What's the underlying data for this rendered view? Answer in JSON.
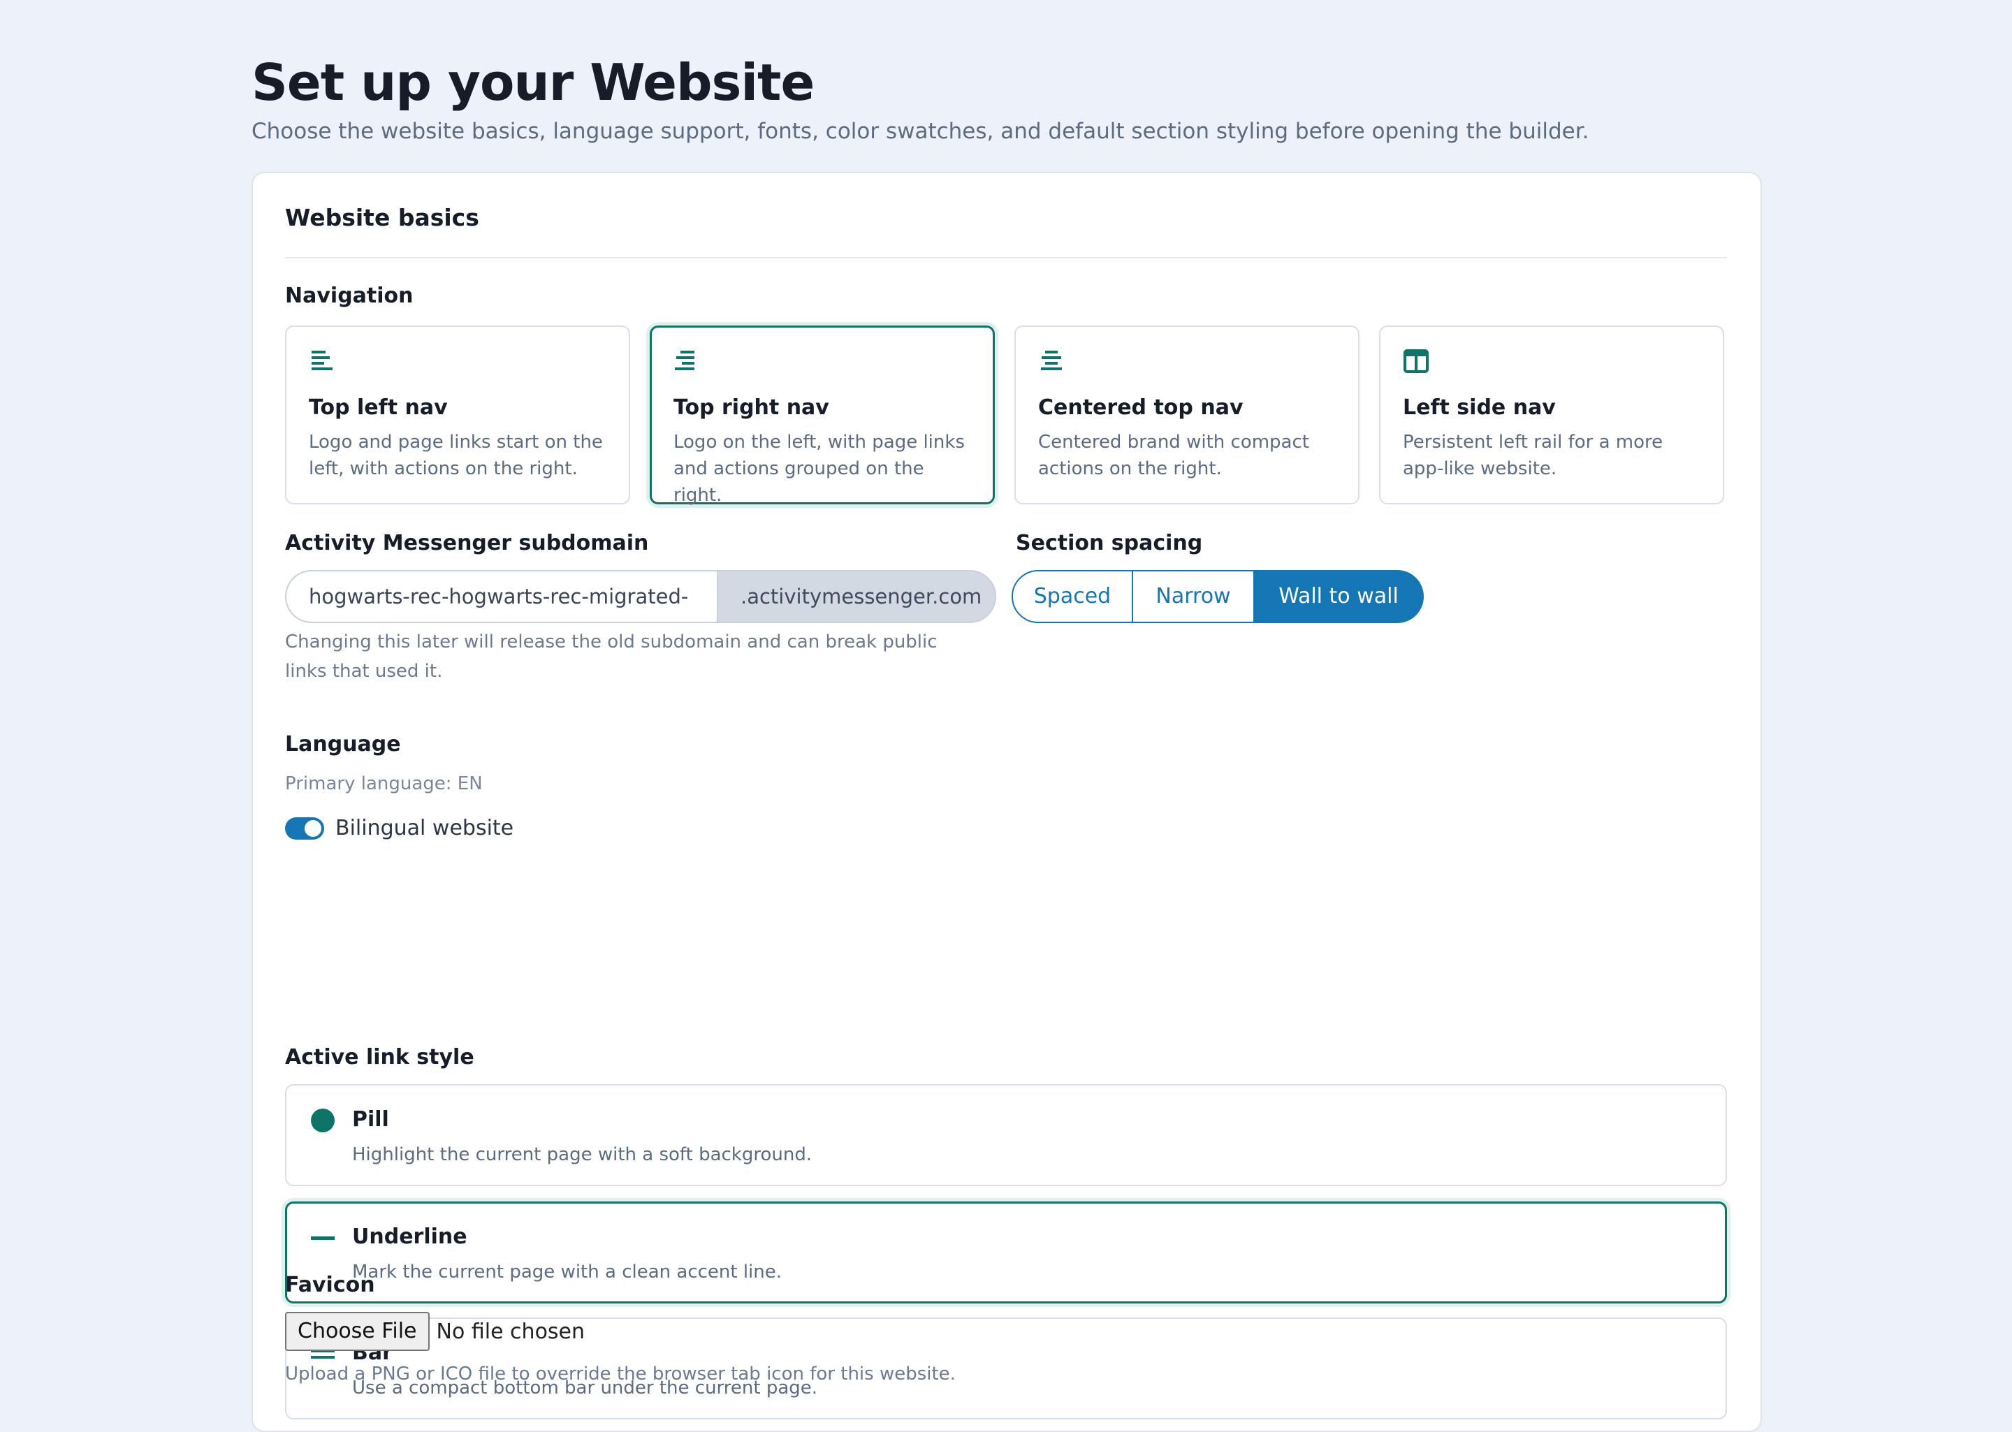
{
  "page": {
    "title": "Set up your Website",
    "subtitle": "Choose the website basics, language support, fonts, color swatches, and default section styling before opening the builder."
  },
  "basics": {
    "title": "Website basics",
    "navigation": {
      "label": "Navigation",
      "selected": "Top right nav",
      "options": [
        {
          "title": "Top left nav",
          "description": "Logo and page links start on the left, with actions on the right.",
          "icon": "align-left-icon"
        },
        {
          "title": "Top right nav",
          "description": "Logo on the left, with page links and actions grouped on the right.",
          "icon": "align-right-icon"
        },
        {
          "title": "Centered top nav",
          "description": "Centered brand with compact actions on the right.",
          "icon": "align-center-icon"
        },
        {
          "title": "Left side nav",
          "description": "Persistent left rail for a more app-like website.",
          "icon": "sidebar-layout-icon"
        }
      ]
    },
    "subdomain": {
      "label": "Activity Messenger subdomain",
      "value": "hogwarts-rec-hogwarts-rec-migrated-",
      "suffix": ".activitymessenger.com",
      "helper": "Changing this later will release the old subdomain and can break public links that used it."
    },
    "spacing": {
      "label": "Section spacing",
      "options": [
        "Spaced",
        "Narrow",
        "Wall to wall"
      ],
      "selected": "Wall to wall"
    },
    "language": {
      "label": "Language",
      "primary": "Primary language: EN",
      "bilingual_label": "Bilingual website",
      "bilingual_enabled": true
    },
    "link_style": {
      "label": "Active link style",
      "selected": "Underline",
      "options": [
        {
          "title": "Pill",
          "description": "Highlight the current page with a soft background.",
          "icon": "pill-dot-icon"
        },
        {
          "title": "Underline",
          "description": "Mark the current page with a clean accent line.",
          "icon": "underline-dash-icon"
        },
        {
          "title": "Bar",
          "description": "Use a compact bottom bar under the current page.",
          "icon": "bar-lines-icon"
        }
      ]
    },
    "favicon": {
      "label": "Favicon",
      "button_label": "Choose File",
      "status": "No file chosen",
      "helper": "Upload a PNG or ICO file to override the browser tab icon for this website."
    }
  },
  "colors": {
    "accent": "#0f7468",
    "primary_blue": "#1576b6",
    "background": "#edf2fa"
  }
}
